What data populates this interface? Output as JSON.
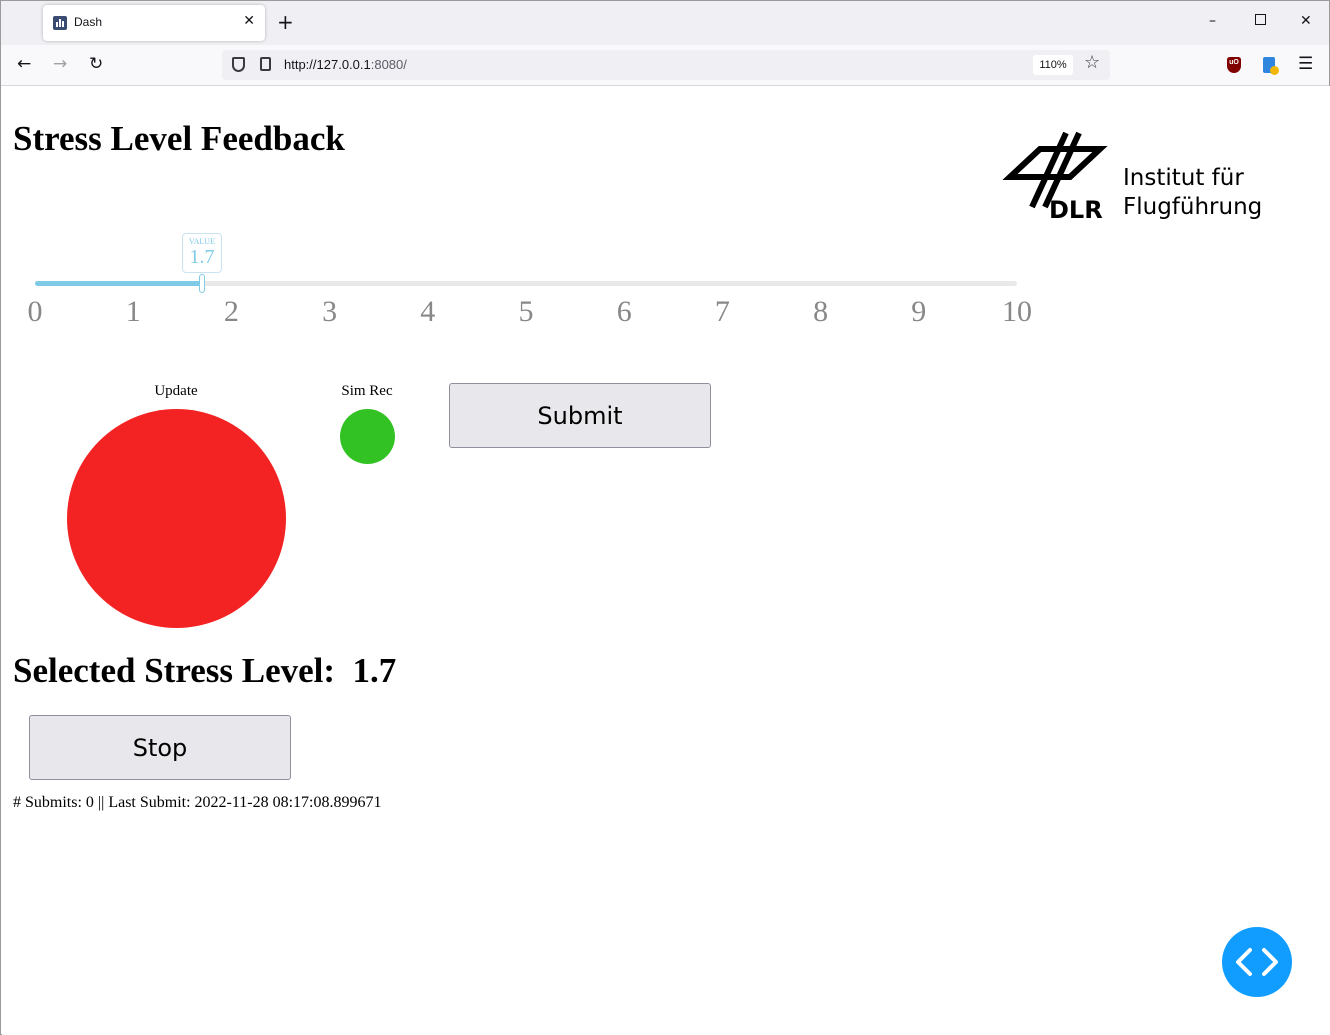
{
  "browser": {
    "tab_title": "Dash",
    "url_scheme_host": "http://127.0.0.1",
    "url_rest": ":8080/",
    "zoom": "110%"
  },
  "page": {
    "title": "Stress Level Feedback",
    "logo": {
      "org_line1": "Institut für",
      "org_line2": "Flugführung",
      "mark_text": "DLR"
    },
    "slider": {
      "tooltip_label": "VALUE",
      "value": 1.7,
      "value_text": "1.7",
      "min": 0,
      "max": 10,
      "ticks": [
        "0",
        "1",
        "2",
        "3",
        "4",
        "5",
        "6",
        "7",
        "8",
        "9",
        "10"
      ]
    },
    "update_label": "Update",
    "sim_rec_label": "Sim Rec",
    "submit_label": "Submit",
    "selected_label": "Selected Stress Level:",
    "selected_value": "1.7",
    "stop_label": "Stop",
    "status_text": "# Submits: 0 || Last Submit: 2022-11-28 08:17:08.899671"
  },
  "colors": {
    "update_led": "#f32323",
    "sim_rec_led": "#32c223",
    "slider_track": "#7fcbe7",
    "debug_button": "#119dff"
  },
  "icons": {
    "back": "arrow-left-icon",
    "forward": "arrow-right-icon",
    "reload": "reload-icon",
    "debug": "code-chevrons-icon"
  }
}
